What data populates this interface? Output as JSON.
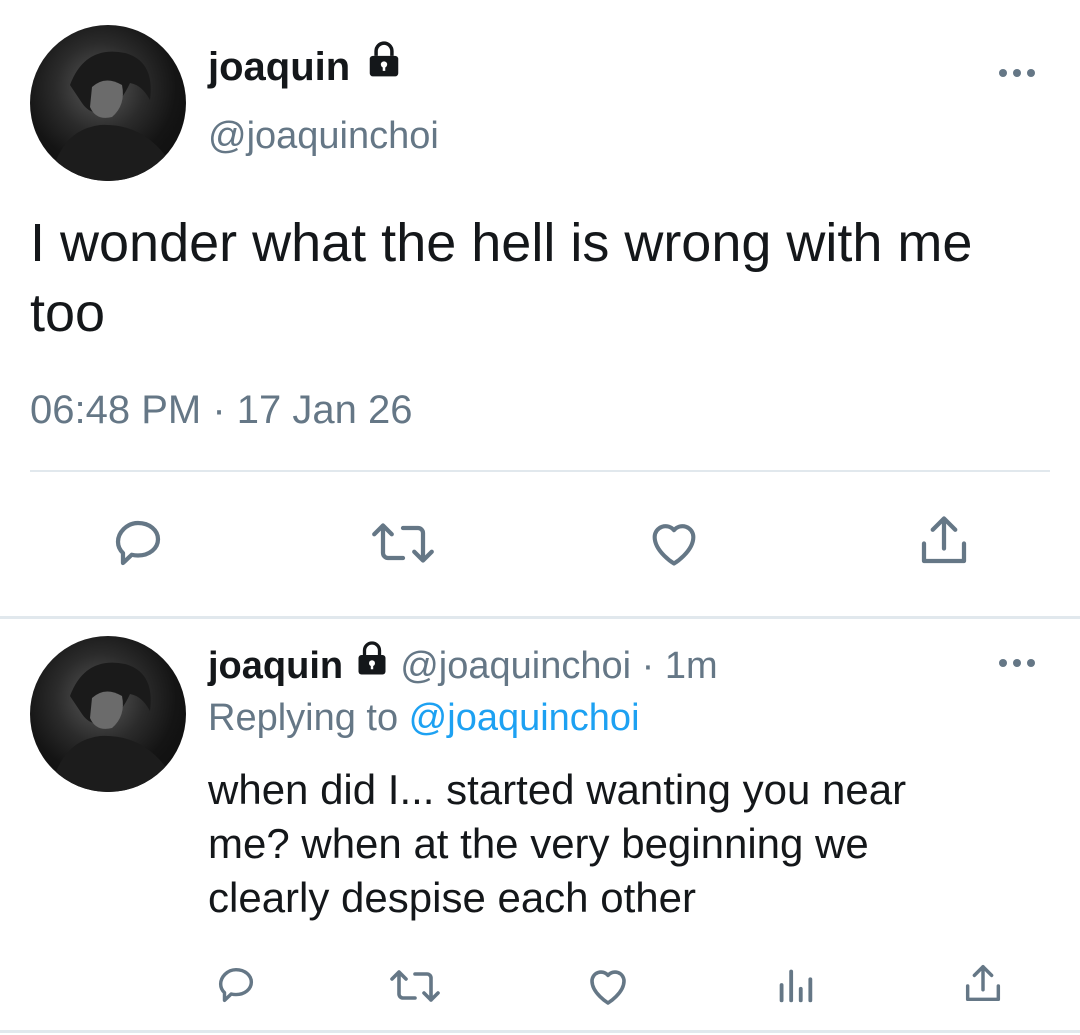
{
  "main_tweet": {
    "display_name": "joaquin",
    "handle": "@joaquinchoi",
    "text_line1": "I wonder what the hell is wrong with me",
    "text_line2": "too",
    "timestamp": "06:48 PM · 17 Jan 26"
  },
  "reply_tweet": {
    "display_name": "joaquin",
    "handle_time": "@joaquinchoi · 1m",
    "replying_prefix": "Replying to ",
    "replying_handle": "@joaquinchoi",
    "text_line1": "when did I... started wanting you near",
    "text_line2": "me? when at the very beginning we",
    "text_line3": "clearly despise each other"
  },
  "icons": {
    "lock": "lock-icon",
    "more": "more-icon",
    "reply": "reply-icon",
    "retweet": "retweet-icon",
    "like": "heart-icon",
    "share": "share-icon",
    "analytics": "analytics-icon"
  },
  "colors": {
    "text": "#14171a",
    "muted": "#657786",
    "link": "#1da1f2",
    "divider": "#e1e8ed"
  }
}
